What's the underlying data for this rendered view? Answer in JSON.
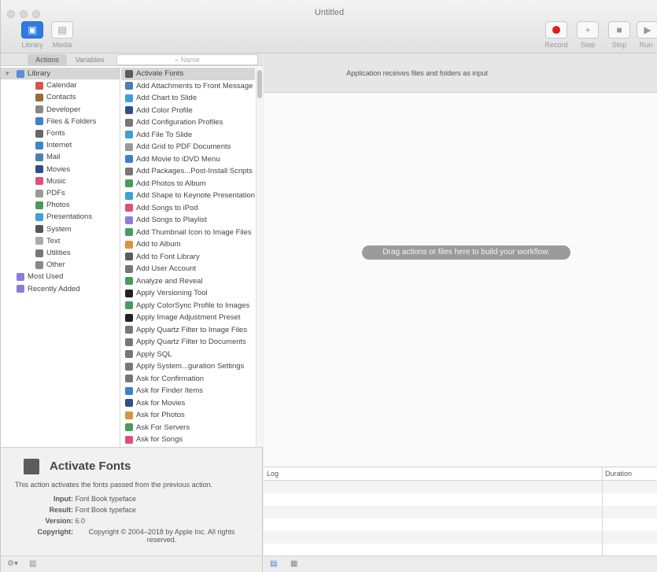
{
  "window": {
    "title": "Untitled"
  },
  "toolbar": {
    "library_label": "Library",
    "media_label": "Media",
    "record_label": "Record",
    "step_label": "Step",
    "stop_label": "Stop",
    "run_label": "Run"
  },
  "library": {
    "tabs": [
      "Actions",
      "Variables"
    ],
    "search_placeholder": "Name",
    "categories": [
      {
        "label": "Library",
        "color": "#5b8fd9"
      },
      {
        "label": "Calendar",
        "color": "#d9534f"
      },
      {
        "label": "Contacts",
        "color": "#9b6b3a"
      },
      {
        "label": "Developer",
        "color": "#888888"
      },
      {
        "label": "Files & Folders",
        "color": "#3f7fcf"
      },
      {
        "label": "Fonts",
        "color": "#666666"
      },
      {
        "label": "Internet",
        "color": "#3f85c9"
      },
      {
        "label": "Mail",
        "color": "#4b7fb5"
      },
      {
        "label": "Movies",
        "color": "#2d4f8c"
      },
      {
        "label": "Music",
        "color": "#e24d7c"
      },
      {
        "label": "PDFs",
        "color": "#999999"
      },
      {
        "label": "Photos",
        "color": "#4a9a5c"
      },
      {
        "label": "Presentations",
        "color": "#3fa0d8"
      },
      {
        "label": "System",
        "color": "#555555"
      },
      {
        "label": "Text",
        "color": "#aaaaaa"
      },
      {
        "label": "Utilities",
        "color": "#777777"
      },
      {
        "label": "Other",
        "color": "#888888"
      },
      {
        "label": "Most Used",
        "color": "#8d7be0"
      },
      {
        "label": "Recently Added",
        "color": "#8d7be0"
      }
    ],
    "actions": [
      {
        "label": "Activate Fonts",
        "color": "#5c5c5c"
      },
      {
        "label": "Add Attachments to Front Message",
        "color": "#4b7fb5"
      },
      {
        "label": "Add Chart to Slide",
        "color": "#3fa0d8"
      },
      {
        "label": "Add Color Profile",
        "color": "#2d4f8c"
      },
      {
        "label": "Add Configuration Profiles",
        "color": "#777777"
      },
      {
        "label": "Add File To Slide",
        "color": "#3fa0d8"
      },
      {
        "label": "Add Grid to PDF Documents",
        "color": "#999999"
      },
      {
        "label": "Add Movie to iDVD Menu",
        "color": "#3f7fcf"
      },
      {
        "label": "Add Packages...Post-Install Scripts",
        "color": "#777777"
      },
      {
        "label": "Add Photos to Album",
        "color": "#4a9a5c"
      },
      {
        "label": "Add Shape to Keynote Presentation",
        "color": "#3fa0d8"
      },
      {
        "label": "Add Songs to iPod",
        "color": "#e24d7c"
      },
      {
        "label": "Add Songs to Playlist",
        "color": "#8d7be0"
      },
      {
        "label": "Add Thumbnail Icon to Image Files",
        "color": "#4a9a5c"
      },
      {
        "label": "Add to Album",
        "color": "#e0913b"
      },
      {
        "label": "Add to Font Library",
        "color": "#5c5c5c"
      },
      {
        "label": "Add User Account",
        "color": "#777777"
      },
      {
        "label": "Analyze and Reveal",
        "color": "#4a9a5c"
      },
      {
        "label": "Apply Versioning Tool",
        "color": "#222222"
      },
      {
        "label": "Apply ColorSync Profile to Images",
        "color": "#4a9a5c"
      },
      {
        "label": "Apply Image Adjustment Preset",
        "color": "#222222"
      },
      {
        "label": "Apply Quartz Filter to Image Files",
        "color": "#777777"
      },
      {
        "label": "Apply Quartz Filter to Documents",
        "color": "#777777"
      },
      {
        "label": "Apply SQL",
        "color": "#777777"
      },
      {
        "label": "Apply System...guration Settings",
        "color": "#777777"
      },
      {
        "label": "Ask for Confirmation",
        "color": "#777777"
      },
      {
        "label": "Ask for Finder Items",
        "color": "#3f7fcf"
      },
      {
        "label": "Ask for Movies",
        "color": "#2d4f8c"
      },
      {
        "label": "Ask for Photos",
        "color": "#e0913b"
      },
      {
        "label": "Ask For Servers",
        "color": "#4a9a5c"
      },
      {
        "label": "Ask for Songs",
        "color": "#e24d7c"
      }
    ]
  },
  "description": {
    "title": "Activate Fonts",
    "text": "This action activates the fonts passed from the previous action.",
    "input_label": "Input:",
    "input_value": "Font Book typeface",
    "result_label": "Result:",
    "result_value": "Font Book typeface",
    "version_label": "Version:",
    "version_value": "6.0",
    "copyright_label": "Copyright:",
    "copyright_value": "Copyright © 2004–2018 by Apple Inc. All rights reserved."
  },
  "workflow": {
    "header_text": "Application receives files and folders as input",
    "drop_hint": "Drag actions or files here to build your workflow."
  },
  "log": {
    "col_log": "Log",
    "col_duration": "Duration"
  }
}
